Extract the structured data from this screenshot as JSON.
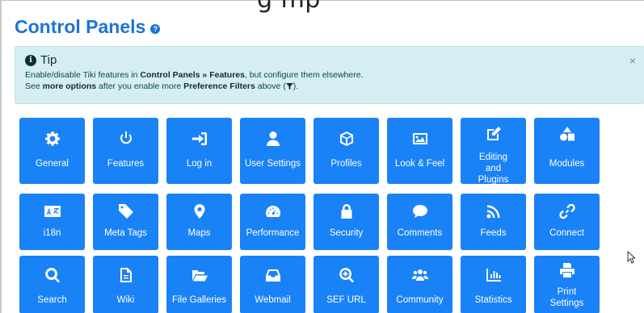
{
  "partial_header": "g    mp",
  "page": {
    "title": "Control Panels",
    "help_glyph": "?"
  },
  "tip": {
    "title": "Tip",
    "info_glyph": "i",
    "close_glyph": "×",
    "line1": {
      "a": "Enable/disable Tiki features in ",
      "b": "Control Panels » Features",
      "c": ", but configure them elsewhere."
    },
    "line2": {
      "a": "See ",
      "b": "more options",
      "c": " after you enable more ",
      "d": "Preference Filters",
      "e": " above (",
      "f": ")."
    }
  },
  "tiles": [
    {
      "label": "General",
      "icon": "gear-icon"
    },
    {
      "label": "Features",
      "icon": "power-icon"
    },
    {
      "label": "Log in",
      "icon": "sign-in-icon"
    },
    {
      "label": "User Settings",
      "icon": "user-icon"
    },
    {
      "label": "Profiles",
      "icon": "cube-icon"
    },
    {
      "label": "Look & Feel",
      "icon": "image-icon"
    },
    {
      "label": "Editing and Plugins",
      "icon": "edit-icon"
    },
    {
      "label": "Modules",
      "icon": "shapes-icon"
    },
    {
      "label": "i18n",
      "icon": "language-icon"
    },
    {
      "label": "Meta Tags",
      "icon": "tag-icon"
    },
    {
      "label": "Maps",
      "icon": "map-marker-icon"
    },
    {
      "label": "Performance",
      "icon": "tachometer-icon"
    },
    {
      "label": "Security",
      "icon": "lock-icon"
    },
    {
      "label": "Comments",
      "icon": "comment-icon"
    },
    {
      "label": "Feeds",
      "icon": "rss-icon"
    },
    {
      "label": "Connect",
      "icon": "link-icon"
    },
    {
      "label": "Search",
      "icon": "search-icon"
    },
    {
      "label": "Wiki",
      "icon": "file-icon"
    },
    {
      "label": "File Galleries",
      "icon": "folder-open-icon"
    },
    {
      "label": "Webmail",
      "icon": "inbox-icon"
    },
    {
      "label": "SEF URL",
      "icon": "search-plus-icon"
    },
    {
      "label": "Community",
      "icon": "users-icon"
    },
    {
      "label": "Statistics",
      "icon": "bar-chart-icon"
    },
    {
      "label": "Print Settings",
      "icon": "print-icon"
    }
  ]
}
